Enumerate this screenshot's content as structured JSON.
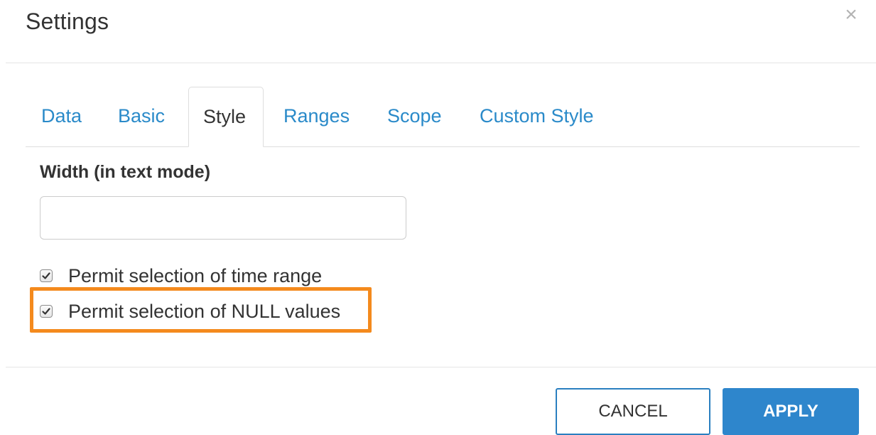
{
  "dialog": {
    "title": "Settings",
    "close_symbol": "×"
  },
  "tabs": [
    {
      "label": "Data",
      "active": false
    },
    {
      "label": "Basic",
      "active": false
    },
    {
      "label": "Style",
      "active": true
    },
    {
      "label": "Ranges",
      "active": false
    },
    {
      "label": "Scope",
      "active": false
    },
    {
      "label": "Custom Style",
      "active": false
    }
  ],
  "style_panel": {
    "width_label": "Width (in text mode)",
    "width_value": "",
    "width_placeholder": "",
    "checkboxes": [
      {
        "label": "Permit selection of time range",
        "checked": true
      },
      {
        "label": "Permit selection of NULL values",
        "checked": true,
        "highlighted": true
      }
    ]
  },
  "footer": {
    "cancel_label": "CANCEL",
    "apply_label": "APPLY"
  },
  "colors": {
    "link_blue": "#2a8ac9",
    "apply_blue": "#2e86cc",
    "highlight_orange": "#f48a1d"
  }
}
